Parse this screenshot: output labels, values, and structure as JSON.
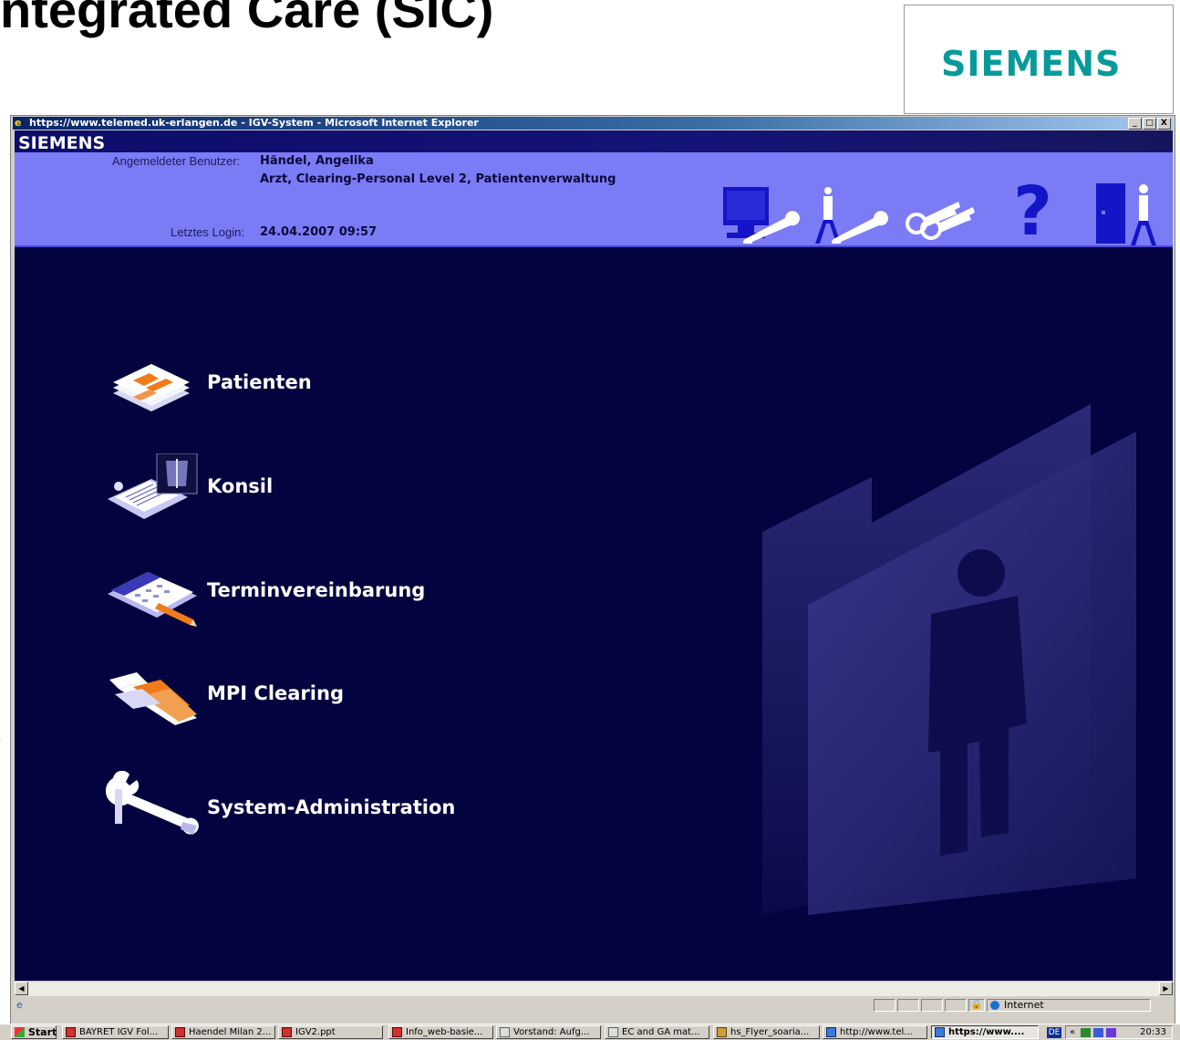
{
  "slide": {
    "title": "ntegrated Care (SIC)",
    "logo": "SIEMENS",
    "paren": ")"
  },
  "window": {
    "title": "https://www.telemed.uk-erlangen.de - IGV-System - Microsoft Internet Explorer",
    "buttons": [
      "_",
      "□",
      "X"
    ]
  },
  "app": {
    "logo": "SIEMENS",
    "user_label": "Angemeldeter Benutzer:",
    "user_name": "Händel, Angelika",
    "user_roles": "Arzt, Clearing-Personal Level 2, Patientenverwaltung",
    "login_label": "Letztes Login:",
    "login_value": "24.04.2007 09:57",
    "toolbar_icons": [
      "computer-wrench-icon",
      "person-wrench-icon",
      "keys-icon",
      "help-icon",
      "logout-icon"
    ],
    "help_glyph": "?",
    "colors": {
      "header": "#7b7bf6",
      "content": "#03033f",
      "accent": "#f07b1a"
    }
  },
  "menu": [
    {
      "label": "Patienten",
      "icon": "patient-cards-icon"
    },
    {
      "label": "Konsil",
      "icon": "clipboard-xray-icon"
    },
    {
      "label": "Terminvereinbarung",
      "icon": "calendar-pen-icon"
    },
    {
      "label": "MPI Clearing",
      "icon": "mpi-clearing-icon"
    },
    {
      "label": "System-Administration",
      "icon": "wrench-icon"
    }
  ],
  "status": {
    "zone": "Internet"
  },
  "taskbar": {
    "start": "Start",
    "items": [
      "BAYRET IGV Fol...",
      "Haendel Milan 2...",
      "IGV2.ppt",
      "Info_web-basie...",
      "Vorstand: Aufg...",
      "EC and GA mat...",
      "hs_Flyer_soaria...",
      "http://www.tel...",
      "https://www...."
    ],
    "lang": "DE",
    "clock": "20:33"
  }
}
